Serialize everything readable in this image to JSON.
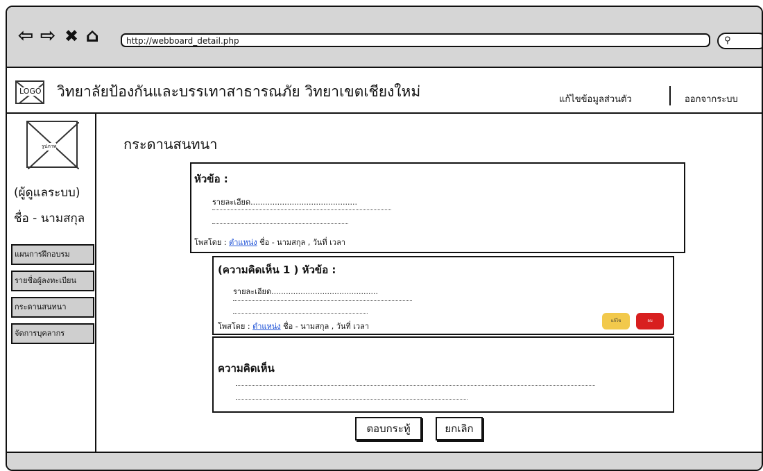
{
  "browser": {
    "url": "http://webboard_detail.php",
    "icons": [
      "back-icon",
      "forward-icon",
      "close-icon",
      "home-icon",
      "search-icon"
    ]
  },
  "header": {
    "logo": "LOGO",
    "title": "วิทยาลัยป้องกันและบรรเทาสาธารณภัย วิทยาเขตเชียงใหม่",
    "edit_profile": "แก้ไขข้อมูลส่วนตัว",
    "logout": "ออกจากระบบ"
  },
  "sidebar": {
    "avatar_label": "รูปภาพ",
    "role": "(ผู้ดูแลระบบ)",
    "name": "ชื่อ - นามสกุล",
    "menu": [
      {
        "label": "แผนการฝึกอบรม"
      },
      {
        "label": "รายชื่อผู้ลงทะเบียน"
      },
      {
        "label": "กระดานสนทนา"
      },
      {
        "label": "จัดการบุคลากร"
      }
    ]
  },
  "main": {
    "page_title": "กระดานสนทนา",
    "topic": {
      "heading": "หัวข้อ :",
      "detail": "รายละเอียด............................................",
      "posted_by": "โพสโดย :",
      "position": "ตำแหน่ง",
      "name_time": "ชื่อ - นามสกุล , วันที่ เวลา"
    },
    "comment": {
      "heading": "(ความคิดเห็น 1 ) หัวข้อ :",
      "detail": "รายละเอียด............................................",
      "posted_by": "โพสโดย :",
      "position": "ตำแหน่ง",
      "name_time": "ชื่อ - นามสกุล , วันที่ เวลา",
      "edit_label": "แก้ไข",
      "delete_label": "ลบ"
    },
    "reply": {
      "heading": "ความคิดเห็น"
    },
    "buttons": {
      "submit": "ตอบกระทู้",
      "cancel": "ยกเลิก"
    }
  },
  "colors": {
    "edit_button": "#f2c94c",
    "delete_button": "#d81f1f",
    "chrome_gray": "#d6d6d6",
    "link": "#1a4fd6"
  }
}
